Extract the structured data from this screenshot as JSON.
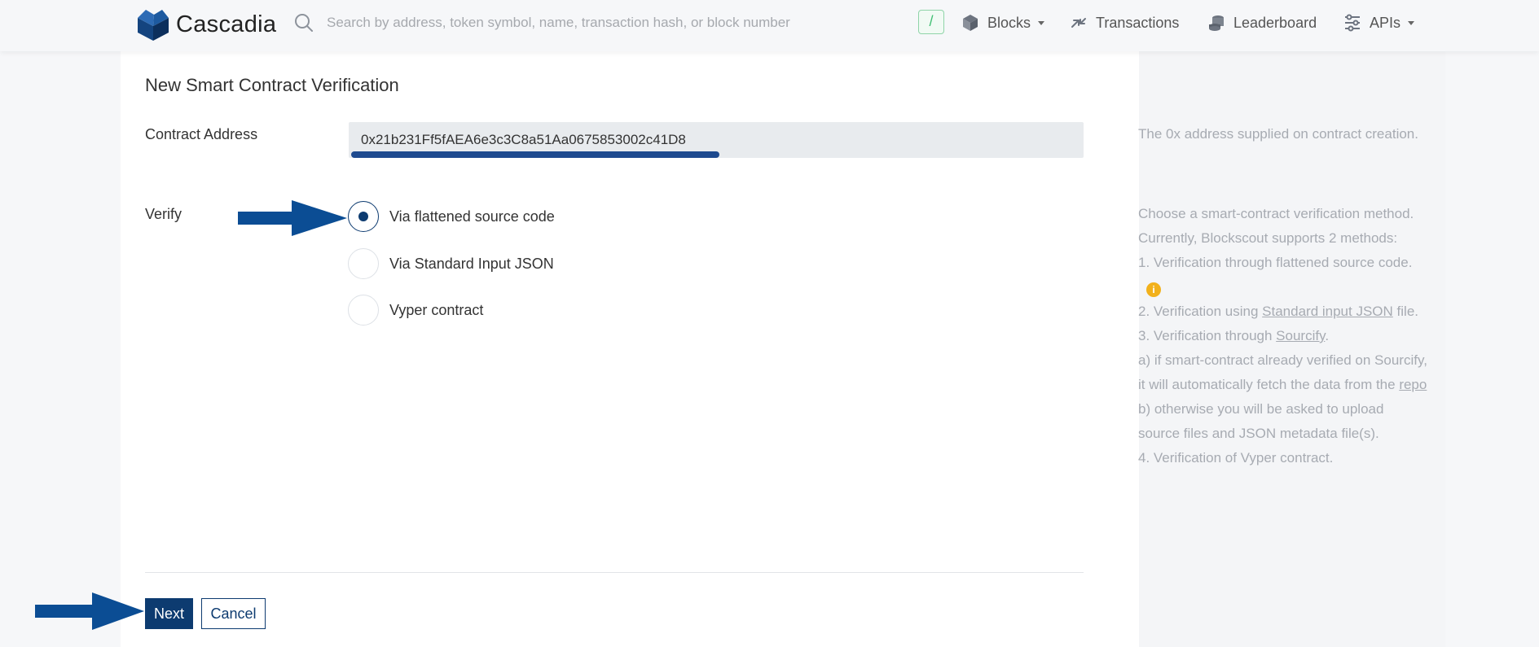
{
  "header": {
    "brand": "Cascadia",
    "search_placeholder": "Search by address, token symbol, name, transaction hash, or block number",
    "slash_hint": "/",
    "nav": {
      "blocks": "Blocks",
      "transactions": "Transactions",
      "leaderboard": "Leaderboard",
      "apis": "APIs"
    }
  },
  "form": {
    "title": "New Smart Contract Verification",
    "address_label": "Contract Address",
    "address_value": "0x21b231Ff5fAEA6e3c3C8a51Aa0675853002c41D8",
    "verify_label": "Verify",
    "options": [
      {
        "label": "Via flattened source code",
        "checked": true
      },
      {
        "label": "Via Standard Input JSON",
        "checked": false
      },
      {
        "label": "Vyper contract",
        "checked": false
      }
    ],
    "next_label": "Next",
    "cancel_label": "Cancel"
  },
  "help": {
    "address_help": "The 0x address supplied on contract creation.",
    "method_intro": "Choose a smart-contract verification method. Currently, Blockscout supports 2 methods:",
    "item1": "1. Verification through flattened source code.",
    "item2_prefix": "2. Verification using ",
    "item2_link": "Standard input JSON",
    "item2_suffix": " file.",
    "item3_prefix": "3. Verification through ",
    "item3_link": "Sourcify",
    "item3_suffix": ".",
    "item3a_prefix": "a) if smart-contract already verified on Sourcify, it will automatically fetch the data from the ",
    "item3a_link": "repo",
    "item3b": "b) otherwise you will be asked to upload source files and JSON metadata file(s).",
    "item4": "4. Verification of Vyper contract.",
    "info_icon": "i"
  },
  "colors": {
    "primary": "#0d3b70",
    "annotation": "#0b4d94",
    "info": "#f2b11b"
  }
}
